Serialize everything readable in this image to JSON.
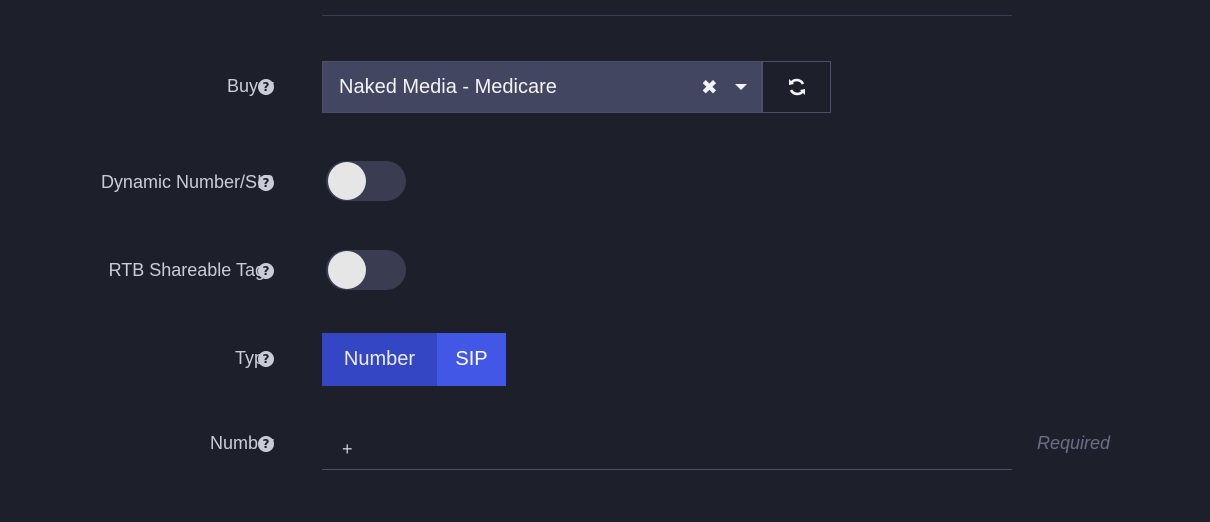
{
  "form": {
    "buyer": {
      "label": "Buyer",
      "help_icon": "question-circle-icon",
      "selected_value": "Naked Media - Medicare",
      "clear_icon": "✖",
      "dropdown_icon": "caret-down-icon",
      "refresh_icon": "refresh-icon"
    },
    "dynamic_number": {
      "label": "Dynamic Number/SIP",
      "help_icon": "question-circle-icon",
      "enabled": false
    },
    "rtb_shareable_tags": {
      "label": "RTB Shareable Tags",
      "help_icon": "question-circle-icon",
      "enabled": false
    },
    "type": {
      "label": "Type",
      "help_icon": "question-circle-icon",
      "options": [
        "Number",
        "SIP"
      ],
      "selected": "SIP"
    },
    "number": {
      "label": "Number",
      "help_icon": "question-circle-icon",
      "prefix": "+",
      "value": "",
      "hint": "Required"
    }
  },
  "theme": {
    "background": "#1d1f2b",
    "select_bg": "#434660",
    "accent": "#4257e6",
    "accent_dark": "#3446c4"
  }
}
